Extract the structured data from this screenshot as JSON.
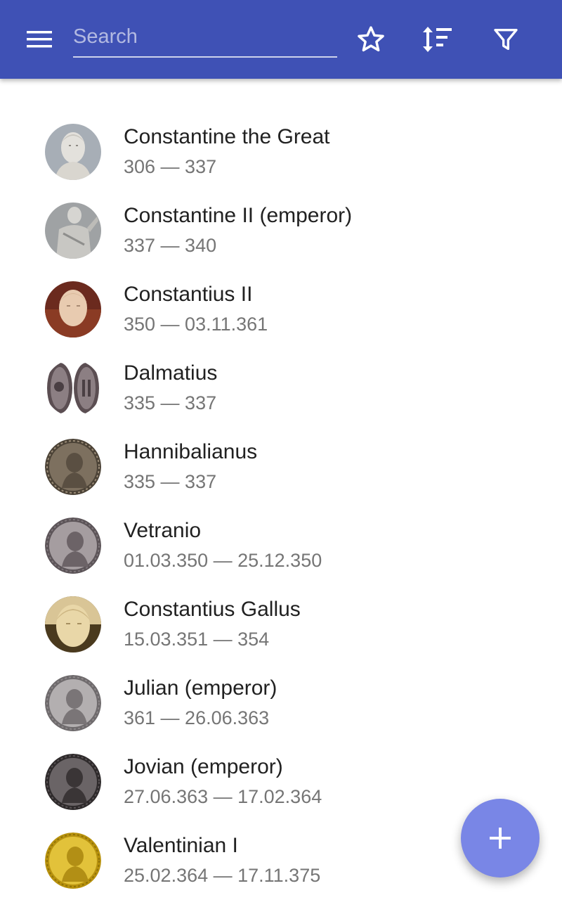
{
  "toolbar": {
    "search_placeholder": "Search",
    "color": "#3f51b5",
    "icons": [
      "menu-icon",
      "star-icon",
      "sort-icon",
      "filter-icon"
    ]
  },
  "rulers": [
    {
      "name": "Constantine the Great",
      "dates": "306 — 337",
      "avatar": "marble-bust"
    },
    {
      "name": "Constantine II (emperor)",
      "dates": "337 — 340",
      "avatar": "statue"
    },
    {
      "name": "Constantius II",
      "dates": "350 — 03.11.361",
      "avatar": "marble-head"
    },
    {
      "name": "Dalmatius",
      "dates": "335 — 337",
      "avatar": "coin-pair"
    },
    {
      "name": "Hannibalianus",
      "dates": "335 — 337",
      "avatar": "bronze-coin"
    },
    {
      "name": "Vetranio",
      "dates": "01.03.350 — 25.12.350",
      "avatar": "silver-coin"
    },
    {
      "name": "Constantius Gallus",
      "dates": "15.03.351 — 354",
      "avatar": "stone-head"
    },
    {
      "name": "Julian (emperor)",
      "dates": "361 — 26.06.363",
      "avatar": "silver-coin"
    },
    {
      "name": "Jovian (emperor)",
      "dates": "27.06.363 — 17.02.364",
      "avatar": "dark-coin"
    },
    {
      "name": "Valentinian I",
      "dates": "25.02.364 — 17.11.375",
      "avatar": "gold-coin"
    }
  ],
  "fab": {
    "icon": "plus-icon",
    "color": "#7986e6"
  }
}
